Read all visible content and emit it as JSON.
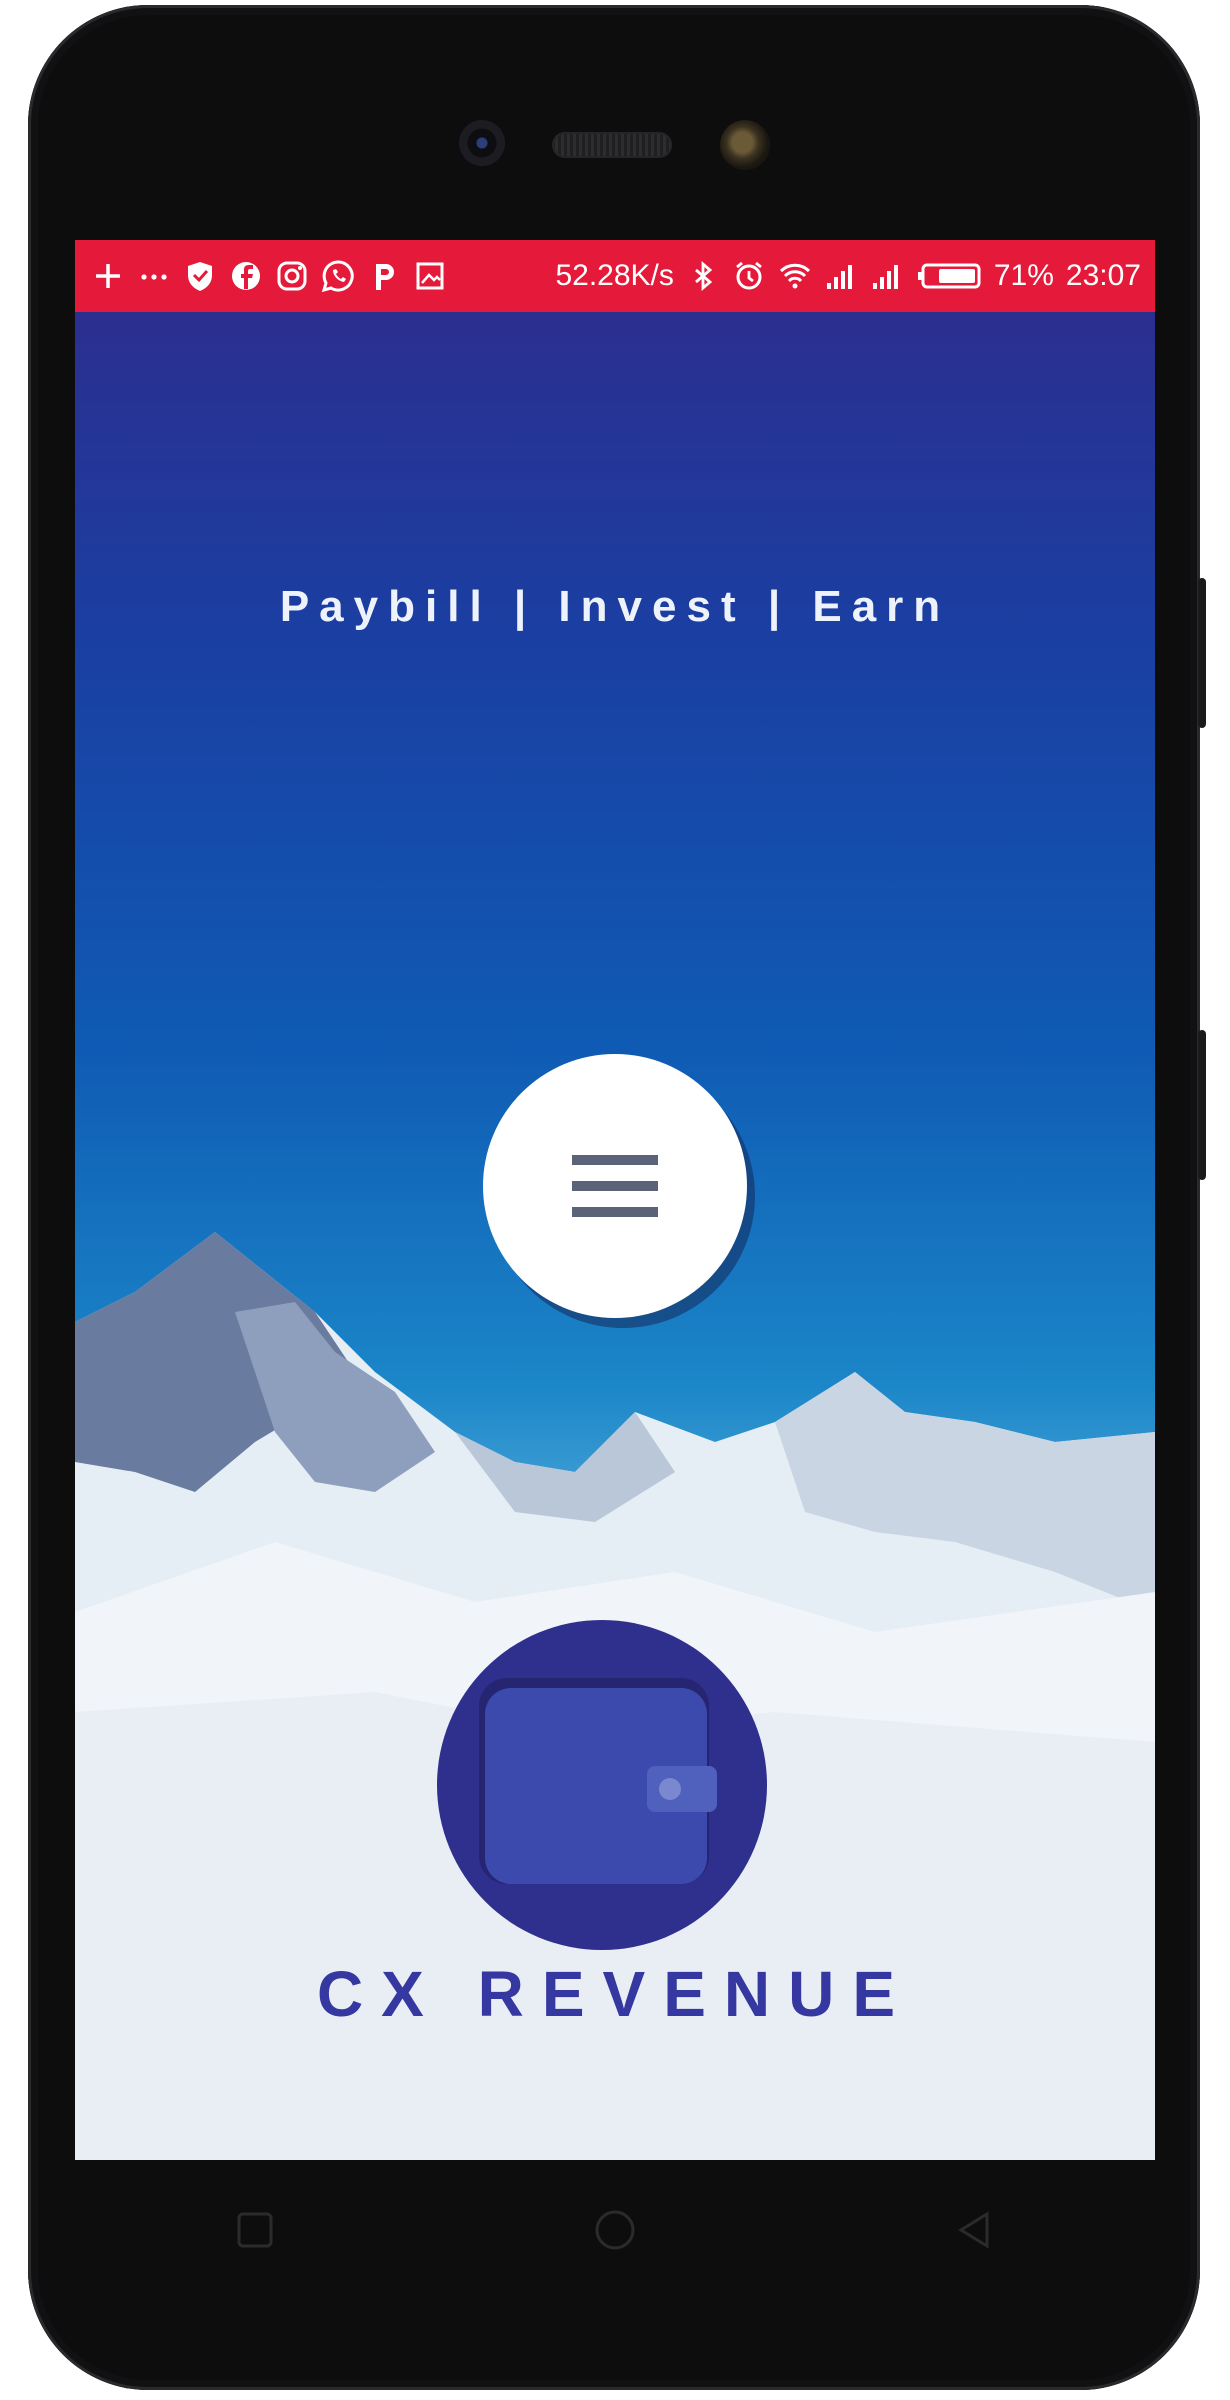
{
  "status_bar": {
    "notification_icons": [
      "plus-icon",
      "more-icon",
      "shield-icon",
      "facebook-icon",
      "instagram-icon",
      "whatsapp-icon",
      "p-icon",
      "image-icon"
    ],
    "network_speed": "52.28K/s",
    "system_icons": [
      "bluetooth-icon",
      "alarm-icon",
      "wifi-icon",
      "signal-icon",
      "signal-icon-2",
      "battery-icon"
    ],
    "battery": "71%",
    "time": "23:07",
    "color": "#e51a3a"
  },
  "splash": {
    "tagline": "Paybill | Invest | Earn",
    "menu_icon": "hamburger-menu-icon",
    "logo_icon": "wallet-icon",
    "brand_name": "CX REVENUE",
    "brand_color": "#3538a0"
  },
  "nav_bar": {
    "buttons": [
      "recent-apps-icon",
      "home-icon",
      "back-icon"
    ]
  }
}
